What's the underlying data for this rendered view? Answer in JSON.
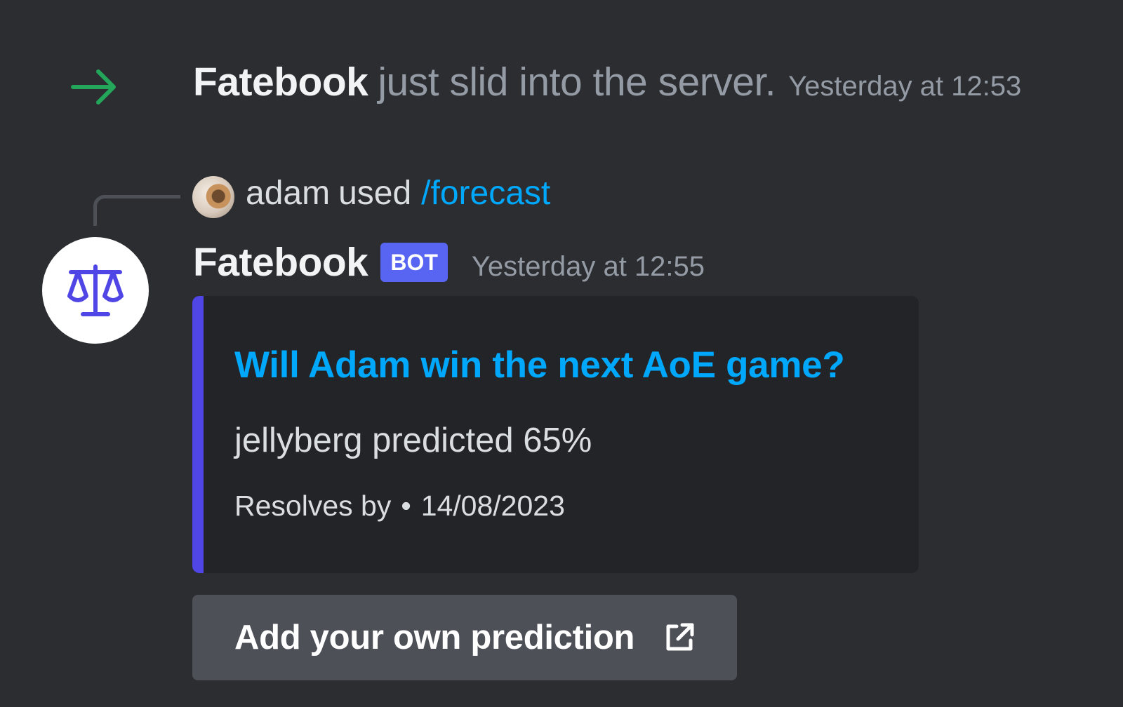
{
  "join_message": {
    "icon": "arrow-right-icon",
    "icon_color": "#23a55a",
    "username": "Fatebook",
    "text": "just slid into the server.",
    "timestamp": "Yesterday at 12:53"
  },
  "command_reference": {
    "avatar": "user-avatar",
    "username": "adam",
    "used_text": "used",
    "command": "/forecast"
  },
  "message": {
    "avatar_icon": "scales-icon",
    "author": "Fatebook",
    "badge": "BOT",
    "timestamp": "Yesterday at 12:55",
    "embed": {
      "accent_color": "#4f46e5",
      "title": "Will Adam win the next AoE game?",
      "description": "jellyberg predicted 65%",
      "footer_label": "Resolves by",
      "footer_separator": "•",
      "footer_date": "14/08/2023"
    },
    "button": {
      "label": "Add your own prediction",
      "icon": "external-link-icon"
    }
  },
  "colors": {
    "background": "#2b2d31",
    "link": "#00a8fc",
    "bot_badge": "#5865f2",
    "muted_text": "#949ba4"
  }
}
